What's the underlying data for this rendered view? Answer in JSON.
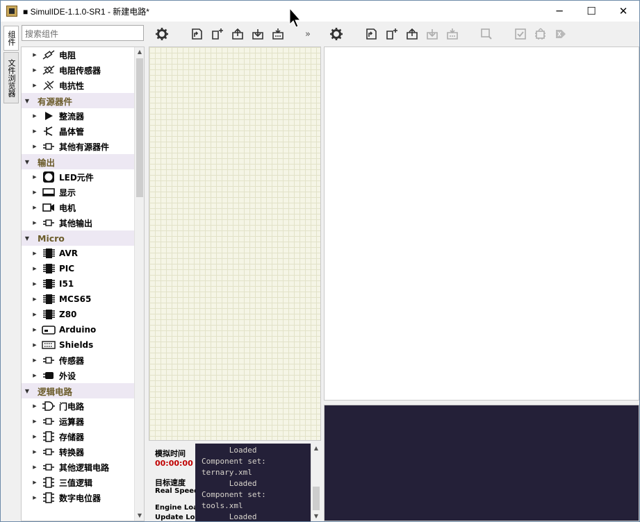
{
  "window": {
    "title": "■ SimulIDE-1.1.0-SR1 - 新建电路*",
    "minimize": "─",
    "maximize": "☐",
    "close": "✕"
  },
  "side_tabs": [
    {
      "label": "组件"
    },
    {
      "label": "文件浏览器"
    }
  ],
  "search": {
    "placeholder": "搜索组件"
  },
  "tree": [
    {
      "type": "item",
      "label": "电阻",
      "icon": "resistor-icon"
    },
    {
      "type": "item",
      "label": "电阻传感器",
      "icon": "resistor-sensor-icon"
    },
    {
      "type": "item",
      "label": "电抗性",
      "icon": "reactive-icon"
    },
    {
      "type": "cat",
      "label": "有源器件"
    },
    {
      "type": "item",
      "label": "整流器",
      "icon": "diode-icon"
    },
    {
      "type": "item",
      "label": "晶体管",
      "icon": "transistor-icon"
    },
    {
      "type": "item",
      "label": "其他有源器件",
      "icon": "chip-small-icon"
    },
    {
      "type": "cat",
      "label": "输出"
    },
    {
      "type": "item",
      "label": "LED元件",
      "icon": "led-icon"
    },
    {
      "type": "item",
      "label": "显示",
      "icon": "display-icon"
    },
    {
      "type": "item",
      "label": "电机",
      "icon": "motor-icon"
    },
    {
      "type": "item",
      "label": "其他输出",
      "icon": "chip-small-icon"
    },
    {
      "type": "cat",
      "label": "Micro"
    },
    {
      "type": "item",
      "label": "AVR",
      "icon": "mcu-icon"
    },
    {
      "type": "item",
      "label": "PIC",
      "icon": "mcu-icon"
    },
    {
      "type": "item",
      "label": "I51",
      "icon": "mcu-icon"
    },
    {
      "type": "item",
      "label": "MCS65",
      "icon": "mcu-icon"
    },
    {
      "type": "item",
      "label": "Z80",
      "icon": "mcu-icon"
    },
    {
      "type": "item",
      "label": "Arduino",
      "icon": "arduino-icon"
    },
    {
      "type": "item",
      "label": "Shields",
      "icon": "shield-board-icon"
    },
    {
      "type": "item",
      "label": "传感器",
      "icon": "chip-small-icon"
    },
    {
      "type": "item",
      "label": "外设",
      "icon": "peripheral-icon"
    },
    {
      "type": "cat",
      "label": "逻辑电路"
    },
    {
      "type": "item",
      "label": "门电路",
      "icon": "gate-icon"
    },
    {
      "type": "item",
      "label": "运算器",
      "icon": "chip-small-icon"
    },
    {
      "type": "item",
      "label": "存储器",
      "icon": "memory-icon"
    },
    {
      "type": "item",
      "label": "转换器",
      "icon": "chip-small-icon"
    },
    {
      "type": "item",
      "label": "其他逻辑电路",
      "icon": "chip-small-icon"
    },
    {
      "type": "item",
      "label": "三值逻辑",
      "icon": "memory-icon"
    },
    {
      "type": "item",
      "label": "数字电位器",
      "icon": "memory-icon"
    }
  ],
  "status": {
    "sim_time_label": "模拟时间",
    "sim_time_value": "00:00:00",
    "target_speed_label": "目标速度",
    "real_speed_label": "Real Speed",
    "engine_label": "Engine Load",
    "update_label": "Update Load"
  },
  "log": {
    "lines": "      Loaded\nComponent set:\nternary.xml\n      Loaded\nComponent set:\ntools.xml\n      Loaded"
  }
}
